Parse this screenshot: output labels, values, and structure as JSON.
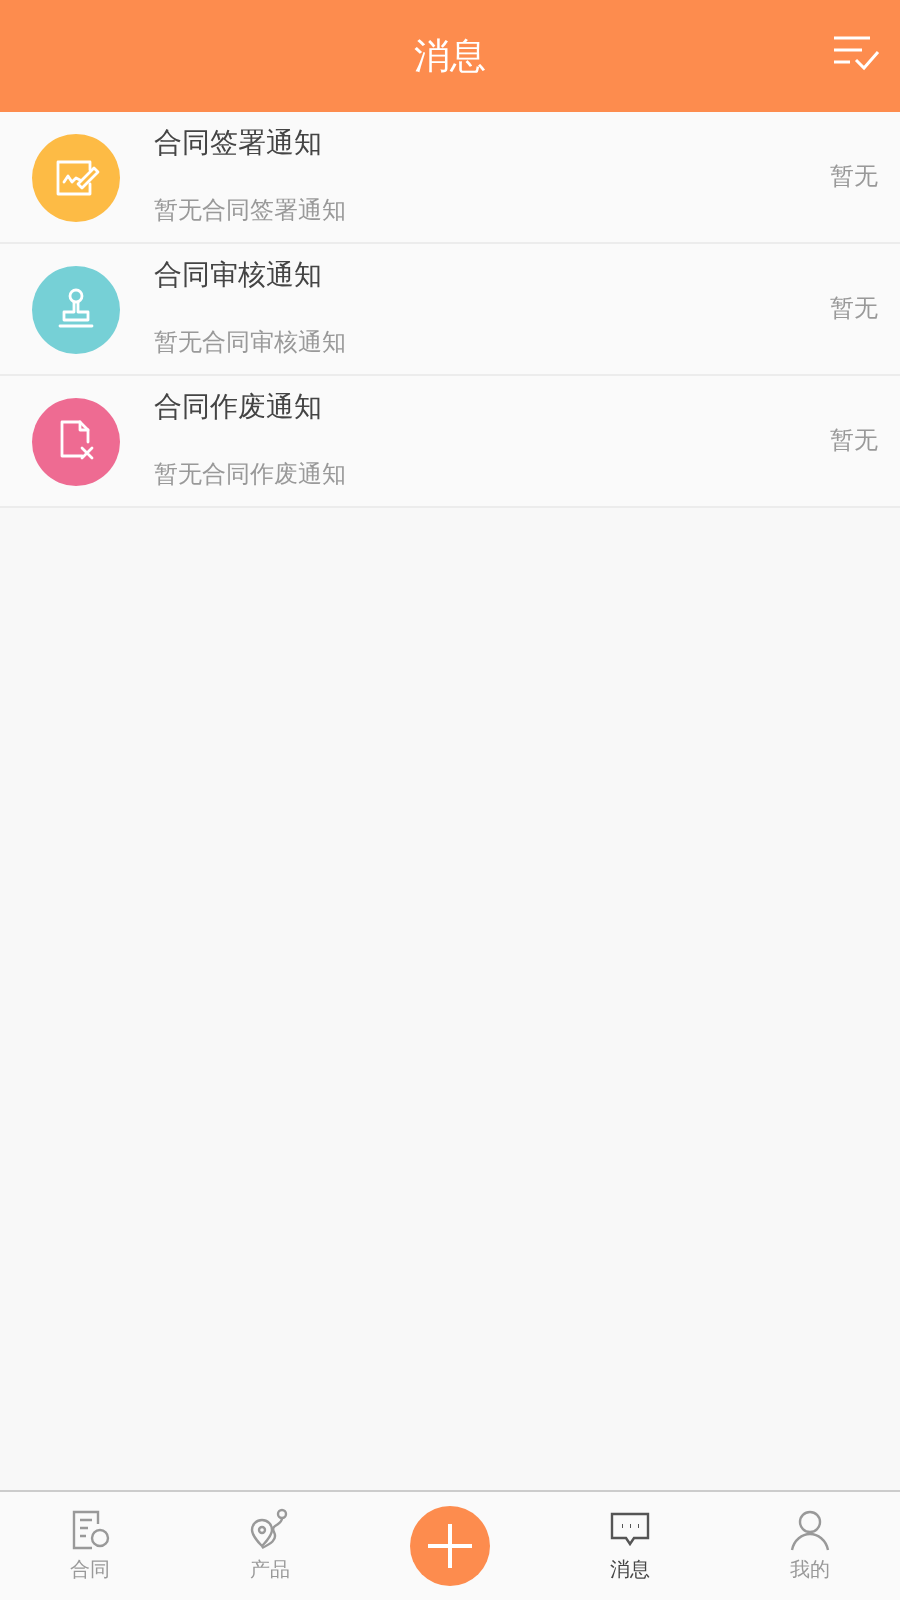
{
  "header": {
    "title": "消息"
  },
  "messages": [
    {
      "kind": "sign",
      "color": "#fdbb45",
      "title": "合同签署通知",
      "preview": "暂无合同签署通知",
      "time": "暂无"
    },
    {
      "kind": "review",
      "color": "#76d0d6",
      "title": "合同审核通知",
      "preview": "暂无合同审核通知",
      "time": "暂无"
    },
    {
      "kind": "void",
      "color": "#ee6b92",
      "title": "合同作废通知",
      "preview": "暂无合同作废通知",
      "time": "暂无"
    }
  ],
  "tabs": [
    {
      "kind": "contract",
      "label": "合同",
      "selected": false
    },
    {
      "kind": "product",
      "label": "产品",
      "selected": false
    },
    {
      "kind": "add"
    },
    {
      "kind": "message",
      "label": "消息",
      "selected": true
    },
    {
      "kind": "profile",
      "label": "我的",
      "selected": false
    }
  ]
}
